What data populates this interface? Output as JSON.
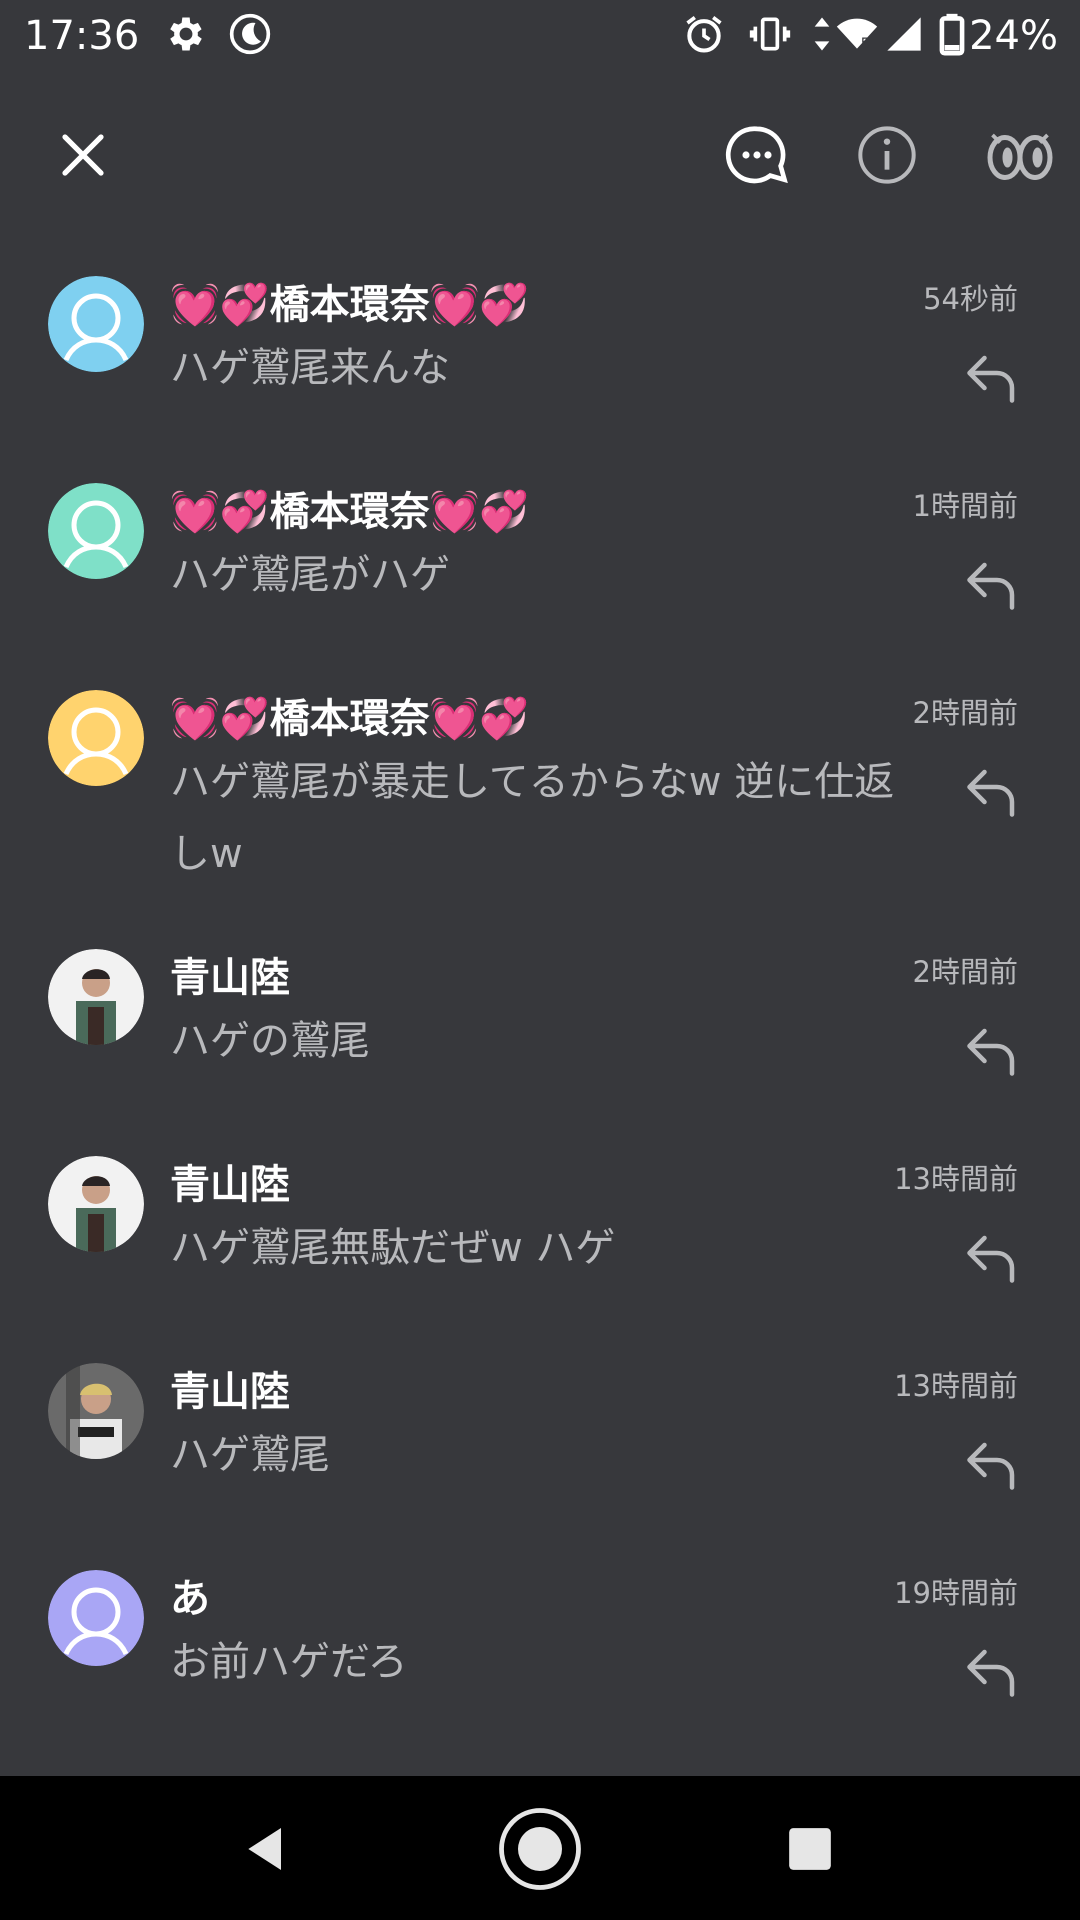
{
  "status_bar": {
    "time": "17:36",
    "battery": "24%",
    "icons": [
      "settings-icon",
      "night-mode-icon",
      "alarm-icon",
      "vibrate-icon",
      "data-arrows-icon",
      "wifi-icon",
      "signal-icon",
      "battery-icon"
    ]
  },
  "toolbar": {
    "icons": [
      "close-icon",
      "chat-bubble-icon",
      "info-icon",
      "eyes-icon"
    ]
  },
  "notifications": [
    {
      "name": "💓💞橋本環奈💓💞",
      "message": "ハゲ鷲尾来んな",
      "time": "54秒前",
      "avatar": "default",
      "avatar_color": "#7fd0f0"
    },
    {
      "name": "💓💞橋本環奈💓💞",
      "message": "ハゲ鷲尾がハゲ",
      "time": "1時間前",
      "avatar": "default",
      "avatar_color": "#7fe0c8"
    },
    {
      "name": "💓💞橋本環奈💓💞",
      "message": "ハゲ鷲尾が暴走してるからなw 逆に仕返しw",
      "time": "2時間前",
      "avatar": "default",
      "avatar_color": "#ffd36e"
    },
    {
      "name": "青山陸",
      "message": "ハゲの鷲尾",
      "time": "2時間前",
      "avatar": "photo",
      "avatar_color": "#4a6a5a"
    },
    {
      "name": "青山陸",
      "message": "ハゲ鷲尾無駄だぜw ハゲ",
      "time": "13時間前",
      "avatar": "photo",
      "avatar_color": "#4a6a5a"
    },
    {
      "name": "青山陸",
      "message": "ハゲ鷲尾",
      "time": "13時間前",
      "avatar": "photo",
      "avatar_color": "#5a5a5a"
    },
    {
      "name": "あ",
      "message": "お前ハゲだろ",
      "time": "19時間前",
      "avatar": "default",
      "avatar_color": "#a9a6f5"
    }
  ],
  "nav_bar": {
    "icons": [
      "back-icon",
      "home-icon",
      "recents-icon"
    ]
  }
}
